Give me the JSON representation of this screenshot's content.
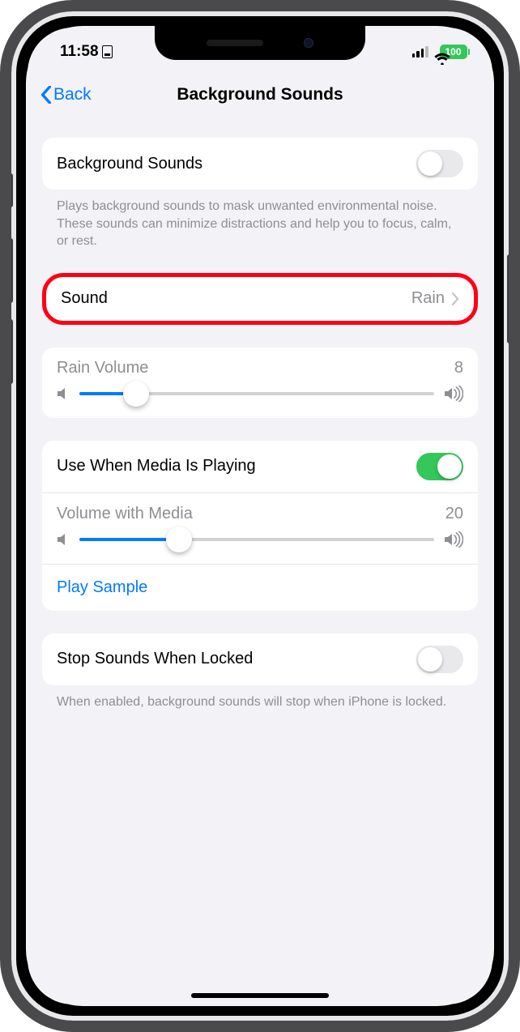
{
  "status": {
    "time": "11:58",
    "battery": "100"
  },
  "nav": {
    "back": "Back",
    "title": "Background Sounds"
  },
  "bgSounds": {
    "label": "Background Sounds",
    "enabled": false,
    "footer": "Plays background sounds to mask unwanted environmental noise. These sounds can minimize distractions and help you to focus, calm, or rest."
  },
  "sound": {
    "label": "Sound",
    "value": "Rain"
  },
  "volume1": {
    "label": "Rain Volume",
    "value": "8",
    "percent": 16
  },
  "media": {
    "label": "Use When Media Is Playing",
    "enabled": true,
    "volLabel": "Volume with Media",
    "volValue": "20",
    "volPercent": 28,
    "sample": "Play Sample"
  },
  "stop": {
    "label": "Stop Sounds When Locked",
    "enabled": false,
    "footer": "When enabled, background sounds will stop when iPhone is locked."
  }
}
